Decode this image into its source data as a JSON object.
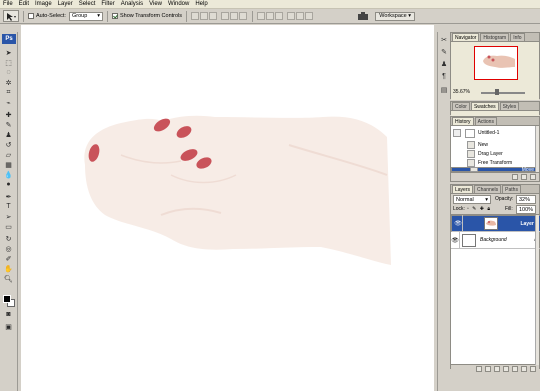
{
  "menu": [
    "File",
    "Edit",
    "Image",
    "Layer",
    "Select",
    "Filter",
    "Analysis",
    "View",
    "Window",
    "Help"
  ],
  "options": {
    "auto_select_label": "Auto-Select:",
    "auto_select_value": "Group",
    "show_transform_label": "Show Transform Controls",
    "workspace_label": "Workspace ▾"
  },
  "tools": {
    "logo": "Ps"
  },
  "navigator": {
    "tabs": [
      "Navigator",
      "Histogram",
      "Info"
    ],
    "zoom": "35.67%"
  },
  "color_panel": {
    "tabs": [
      "Color",
      "Swatches",
      "Styles"
    ]
  },
  "history": {
    "tabs": [
      "History",
      "Actions"
    ],
    "snapshot": "Untitled-1",
    "items": [
      "New",
      "Drag Layer",
      "Free Transform",
      "Move"
    ]
  },
  "layers": {
    "tabs": [
      "Layers",
      "Channels",
      "Paths"
    ],
    "blend_mode": "Normal",
    "opacity_label": "Opacity:",
    "opacity_value": "32%",
    "lock_label": "Lock:",
    "fill_label": "Fill:",
    "fill_value": "100%",
    "rows": [
      {
        "name": "Layer 1",
        "selected": true
      },
      {
        "name": "Background",
        "selected": false
      }
    ]
  },
  "colors": {
    "selection": "#2a55a8",
    "nail": "#c9535a",
    "skin": "#f7ece6"
  }
}
